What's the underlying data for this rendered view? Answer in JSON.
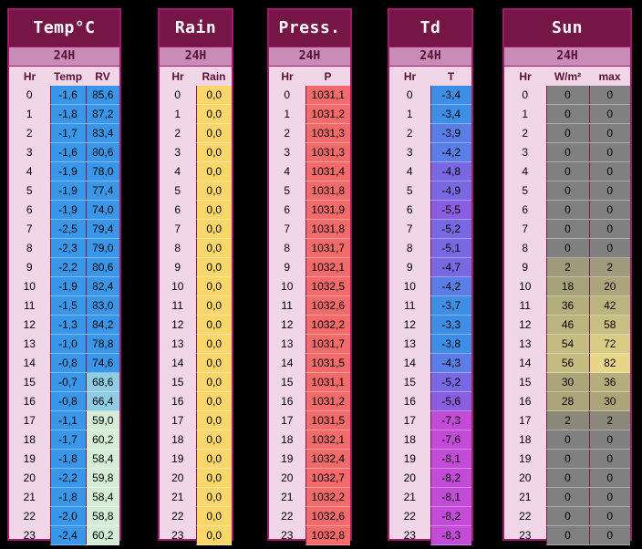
{
  "temp": {
    "title": "Temp°C",
    "subtitle": "24H",
    "headers": [
      "Hr",
      "Temp",
      "RV"
    ],
    "hours": [
      "0",
      "1",
      "2",
      "3",
      "4",
      "5",
      "6",
      "7",
      "8",
      "9",
      "10",
      "11",
      "12",
      "13",
      "14",
      "15",
      "16",
      "17",
      "18",
      "19",
      "20",
      "21",
      "22",
      "23"
    ],
    "temp": [
      "-1,6",
      "-1,8",
      "-1,7",
      "-1,6",
      "-1,9",
      "-1,9",
      "-1,9",
      "-2,5",
      "-2,3",
      "-2,2",
      "-1,9",
      "-1,5",
      "-1,3",
      "-1,0",
      "-0,8",
      "-0,7",
      "-0,8",
      "-1,1",
      "-1,7",
      "-1,8",
      "-2,2",
      "-1,8",
      "-2,0",
      "-2,4"
    ],
    "rv": [
      "85,6",
      "87,2",
      "83,4",
      "80,6",
      "78,0",
      "77,4",
      "74,0",
      "79,4",
      "79,0",
      "80,6",
      "82,4",
      "83,0",
      "84,2",
      "78,8",
      "74,6",
      "68,6",
      "66,4",
      "59,0",
      "60,2",
      "58,4",
      "59,8",
      "58,4",
      "58,8",
      "60,2"
    ],
    "temp_color": "#3a96e8",
    "rv_colors": [
      "#3a96e8",
      "#3a96e8",
      "#3a96e8",
      "#3a96e8",
      "#3a96e8",
      "#3a96e8",
      "#3a96e8",
      "#3a96e8",
      "#3a96e8",
      "#3a96e8",
      "#3a96e8",
      "#3a96e8",
      "#3a96e8",
      "#3a96e8",
      "#3a96e8",
      "#8fcde4",
      "#8fcde4",
      "#d6ecd6",
      "#d6ecd6",
      "#d6ecd6",
      "#d6ecd6",
      "#d6ecd6",
      "#d6ecd6",
      "#d6ecd6"
    ]
  },
  "rain": {
    "title": "Rain",
    "subtitle": "24H",
    "headers": [
      "Hr",
      "Rain"
    ],
    "rain": [
      "0,0",
      "0,0",
      "0,0",
      "0,0",
      "0,0",
      "0,0",
      "0,0",
      "0,0",
      "0,0",
      "0,0",
      "0,0",
      "0,0",
      "0,0",
      "0,0",
      "0,0",
      "0,0",
      "0,0",
      "0,0",
      "0,0",
      "0,0",
      "0,0",
      "0,0",
      "0,0",
      "0,0"
    ],
    "color": "#fbd66a"
  },
  "press": {
    "title": "Press.",
    "subtitle": "24H",
    "headers": [
      "Hr",
      "P"
    ],
    "p": [
      "1031,1",
      "1031,2",
      "1031,3",
      "1031,3",
      "1031,4",
      "1031,8",
      "1031,9",
      "1031,8",
      "1031,7",
      "1032,1",
      "1032,5",
      "1032,6",
      "1032,2",
      "1031,7",
      "1031,5",
      "1031,1",
      "1031,2",
      "1031,5",
      "1032,1",
      "1032,4",
      "1032,7",
      "1032,2",
      "1032,6",
      "1032,8"
    ],
    "color": "#f26a6a"
  },
  "td": {
    "title": "Td",
    "subtitle": "24H",
    "headers": [
      "Hr",
      "T"
    ],
    "t": [
      "-3,4",
      "-3,4",
      "-3,9",
      "-4,2",
      "-4,8",
      "-4,9",
      "-5,5",
      "-5,2",
      "-5,1",
      "-4,7",
      "-4,2",
      "-3,7",
      "-3,3",
      "-3,8",
      "-4,3",
      "-5,2",
      "-5,6",
      "-7,3",
      "-7,6",
      "-8,1",
      "-8,2",
      "-8,1",
      "-8,2",
      "-8,3"
    ],
    "colors": [
      "#3f8ee6",
      "#3f8ee6",
      "#5a7ee6",
      "#5a7ee6",
      "#7868e2",
      "#7868e2",
      "#8a5ee0",
      "#7868e2",
      "#7868e2",
      "#7868e2",
      "#5a7ee6",
      "#3f8ee6",
      "#3f8ee6",
      "#3f8ee6",
      "#5a7ee6",
      "#7868e2",
      "#8a5ee0",
      "#c24cd8",
      "#c24cd8",
      "#c24cd8",
      "#c24cd8",
      "#c24cd8",
      "#c24cd8",
      "#c24cd8"
    ]
  },
  "sun": {
    "title": "Sun",
    "subtitle": "24H",
    "headers": [
      "Hr",
      "W/m²",
      "max"
    ],
    "wm2": [
      "0",
      "0",
      "0",
      "0",
      "0",
      "0",
      "0",
      "0",
      "0",
      "2",
      "18",
      "36",
      "46",
      "54",
      "56",
      "30",
      "28",
      "2",
      "0",
      "0",
      "0",
      "0",
      "0",
      "0"
    ],
    "max": [
      "0",
      "0",
      "0",
      "0",
      "0",
      "0",
      "0",
      "0",
      "0",
      "2",
      "20",
      "42",
      "58",
      "72",
      "82",
      "36",
      "30",
      "2",
      "0",
      "0",
      "0",
      "0",
      "0",
      "0"
    ],
    "wm2_colors": [
      "#808080",
      "#808080",
      "#808080",
      "#808080",
      "#808080",
      "#808080",
      "#808080",
      "#808080",
      "#808080",
      "#a09a7c",
      "#a8a27a",
      "#b4ad7c",
      "#bcb47e",
      "#c4bc80",
      "#c4bc80",
      "#aca57a",
      "#aca57a",
      "#8a8878",
      "#808080",
      "#808080",
      "#808080",
      "#808080",
      "#808080",
      "#808080"
    ],
    "max_colors": [
      "#808080",
      "#808080",
      "#808080",
      "#808080",
      "#808080",
      "#808080",
      "#808080",
      "#808080",
      "#808080",
      "#a09a7c",
      "#aca57a",
      "#bcb47e",
      "#c8c082",
      "#d8cc84",
      "#e8d688",
      "#b4ad7c",
      "#aca57a",
      "#8a8878",
      "#808080",
      "#808080",
      "#808080",
      "#808080",
      "#808080",
      "#808080"
    ]
  }
}
